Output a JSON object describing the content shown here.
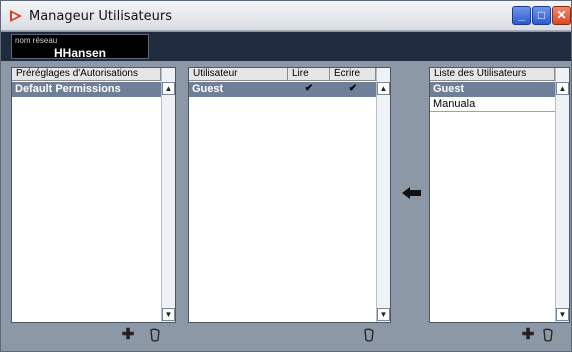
{
  "window": {
    "title": "Manageur Utilisateurs",
    "controls": {
      "minimize": "_",
      "maximize": "□",
      "close": "✕"
    }
  },
  "network_user": {
    "label": "nom réseau",
    "value": "HHansen"
  },
  "presets_panel": {
    "header": "Préréglages d'Autorisations",
    "items": [
      {
        "label": "Default Permissions",
        "selected": true
      }
    ]
  },
  "permissions_panel": {
    "columns": {
      "user": "Utilisateur",
      "read": "Lire",
      "write": "Écrire"
    },
    "rows": [
      {
        "user": "Guest",
        "read": "✔",
        "write": "✔",
        "selected": true
      }
    ]
  },
  "users_panel": {
    "header": "Liste des Utilisateurs",
    "items": [
      {
        "label": "Guest",
        "selected": true
      },
      {
        "label": "Manuala",
        "selected": false
      }
    ]
  },
  "icons": {
    "add": "✚",
    "remove": "remove-icon",
    "transfer": "arrow-left-icon",
    "scroll_up": "▲",
    "scroll_down": "▼"
  }
}
